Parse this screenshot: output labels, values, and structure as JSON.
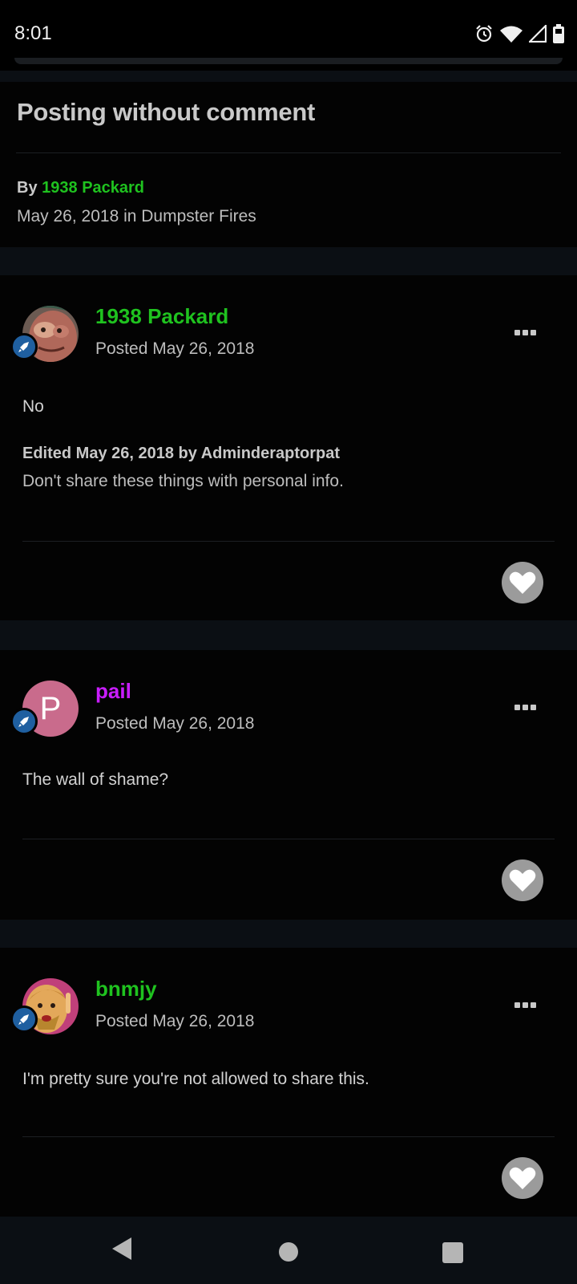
{
  "status_bar": {
    "time": "8:01",
    "icons": [
      "alarm-icon",
      "wifi-icon",
      "signal-icon",
      "battery-icon"
    ]
  },
  "topic": {
    "title": "Posting without comment",
    "by_prefix": "By",
    "author": "1938 Packard",
    "date_line": "May 26, 2018 in Dumpster Fires"
  },
  "posts": [
    {
      "author": "1938 Packard",
      "author_color": "#1fc21f",
      "posted": "Posted May 26, 2018",
      "body": "No",
      "edited_title": "Edited May 26, 2018 by Adminderaptorpat",
      "edited_reason": "Don't share these things with personal info."
    },
    {
      "author": "pail",
      "author_color": "#c91dff",
      "avatar_letter": "P",
      "posted": "Posted May 26, 2018",
      "body": "The wall of shame?"
    },
    {
      "author": "bnmjy",
      "author_color": "#1fc21f",
      "posted": "Posted May 26, 2018",
      "body": "I'm pretty sure you're not allowed to share this."
    }
  ],
  "colors": {
    "background": "#0b0f14",
    "card": "#030303",
    "link_green": "#1fc21f",
    "link_purple": "#c91dff",
    "badge_blue": "#1f5fa0",
    "avatar_pink": "#c96b8c"
  },
  "nav_bar": {
    "icons": [
      "back-icon",
      "home-icon",
      "recents-icon"
    ]
  }
}
